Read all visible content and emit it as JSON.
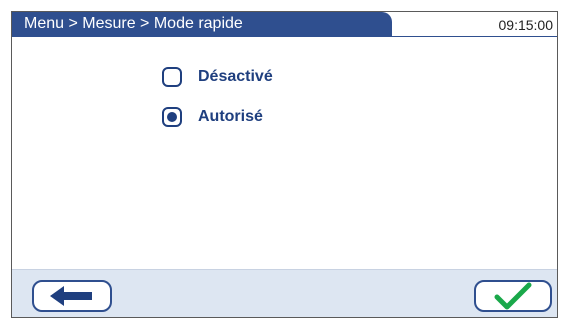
{
  "header": {
    "breadcrumb": "Menu > Mesure > Mode rapide",
    "time": "09:15:00"
  },
  "options": [
    {
      "label": "Désactivé",
      "selected": false
    },
    {
      "label": "Autorisé",
      "selected": true
    }
  ],
  "footer": {
    "back_icon": "arrow-left-icon",
    "confirm_icon": "checkmark-icon"
  },
  "colors": {
    "header_bg": "#2f4f8f",
    "accent": "#1f3f7f",
    "footer_bg": "#dde6f2",
    "check": "#1aa84a"
  }
}
